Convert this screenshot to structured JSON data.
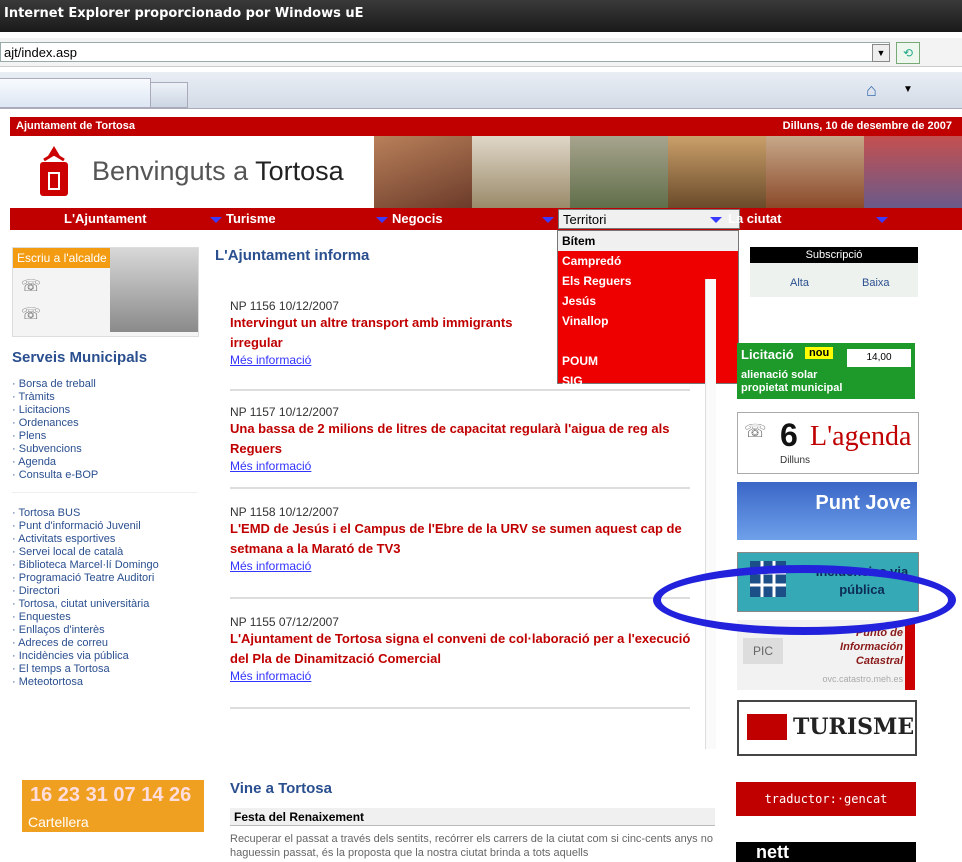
{
  "browser": {
    "title": "Internet Explorer proporcionado por Windows uE",
    "address": "ajt/index.asp"
  },
  "site": {
    "topbar_left": "Ajuntament de Tortosa",
    "topbar_right": "Dilluns, 10 de desembre de 2007",
    "welcome_prefix": "Benvinguts a ",
    "welcome_city": "Tortosa"
  },
  "nav": [
    {
      "label": "L'Ajuntament"
    },
    {
      "label": "Turisme"
    },
    {
      "label": "Negocis"
    },
    {
      "label": "Territori"
    },
    {
      "label": "La ciutat"
    }
  ],
  "dropdown": [
    "Bítem",
    "Campredó",
    "Els Reguers",
    "Jesús",
    "Vinallop",
    "",
    "POUM",
    "SIG"
  ],
  "left": {
    "alcalde_title": "Escriu a l'alcalde",
    "serveis_title": "Serveis Municipals",
    "links1": [
      "Borsa de treball",
      "Tràmits",
      "Licitacions",
      "Ordenances",
      "Plens",
      "Subvencions",
      "Agenda",
      "Consulta e-BOP"
    ],
    "links2": [
      "Tortosa BUS",
      "Punt d'informació Juvenil",
      "Activitats esportives",
      "Servei local de català",
      "Biblioteca Marcel·lí Domingo",
      "Programació Teatre Auditori",
      "Directori",
      "Tortosa, ciutat universitària",
      "Enquestes",
      "Enllaços d'interès",
      "Adreces de correu",
      "Incidències via pública",
      "El temps a Tortosa",
      "Meteotortosa"
    ]
  },
  "news": {
    "title": "L'Ajuntament informa",
    "items": [
      {
        "meta": "NP 1156    10/12/2007",
        "headline": "Intervingut un altre transport amb immigrants irregular",
        "more": "Més informació"
      },
      {
        "meta": "NP 1157    10/12/2007",
        "headline": "Una bassa de 2 milions de litres de capacitat regularà l'aigua de reg als Reguers",
        "more": "Més informació"
      },
      {
        "meta": "NP 1158    10/12/2007",
        "headline": "L'EMD de Jesús i el Campus de l'Ebre de la URV se sumen aquest cap de setmana a la Marató de TV3",
        "more": "Més informació"
      },
      {
        "meta": "NP 1155    07/12/2007",
        "headline": "L'Ajuntament de Tortosa signa el conveni de col·laboració per a l'execució del Pla de Dinamització Comercial",
        "more": "Més informació"
      }
    ]
  },
  "right": {
    "subscripcio": "Subscripció",
    "alta": "Alta",
    "baixa": "Baixa",
    "licitacio": "Licitació",
    "nou": "nou",
    "licit_time": "14,00",
    "licit_desc": "alienació solar propietat municipal",
    "agenda_num": "6",
    "agenda_label": "L'agenda",
    "agenda_day": "Dilluns",
    "punt_jove": "Punt Jove",
    "incidencies": "Incidències via pública",
    "punto_catastral": "Punto de Información Catastral",
    "pic": "PIC",
    "catastro_url": "ovc.catastro.meh.es",
    "turisme": "TURISME"
  },
  "bottom": {
    "cartellera_nums": "16 23 31 07 14 26",
    "cartellera": "Cartellera",
    "vine_title": "Vine a Tortosa",
    "festa_title": "Festa del Renaixement",
    "festa_text": "Recuperar el passat a través dels sentits, recórrer els carrers de la ciutat com si cinc-cents anys no haguessin passat, és la proposta que la nostra ciutat brinda a tots aquells",
    "traductor": "traductor:·gencat",
    "nett": "nett"
  }
}
